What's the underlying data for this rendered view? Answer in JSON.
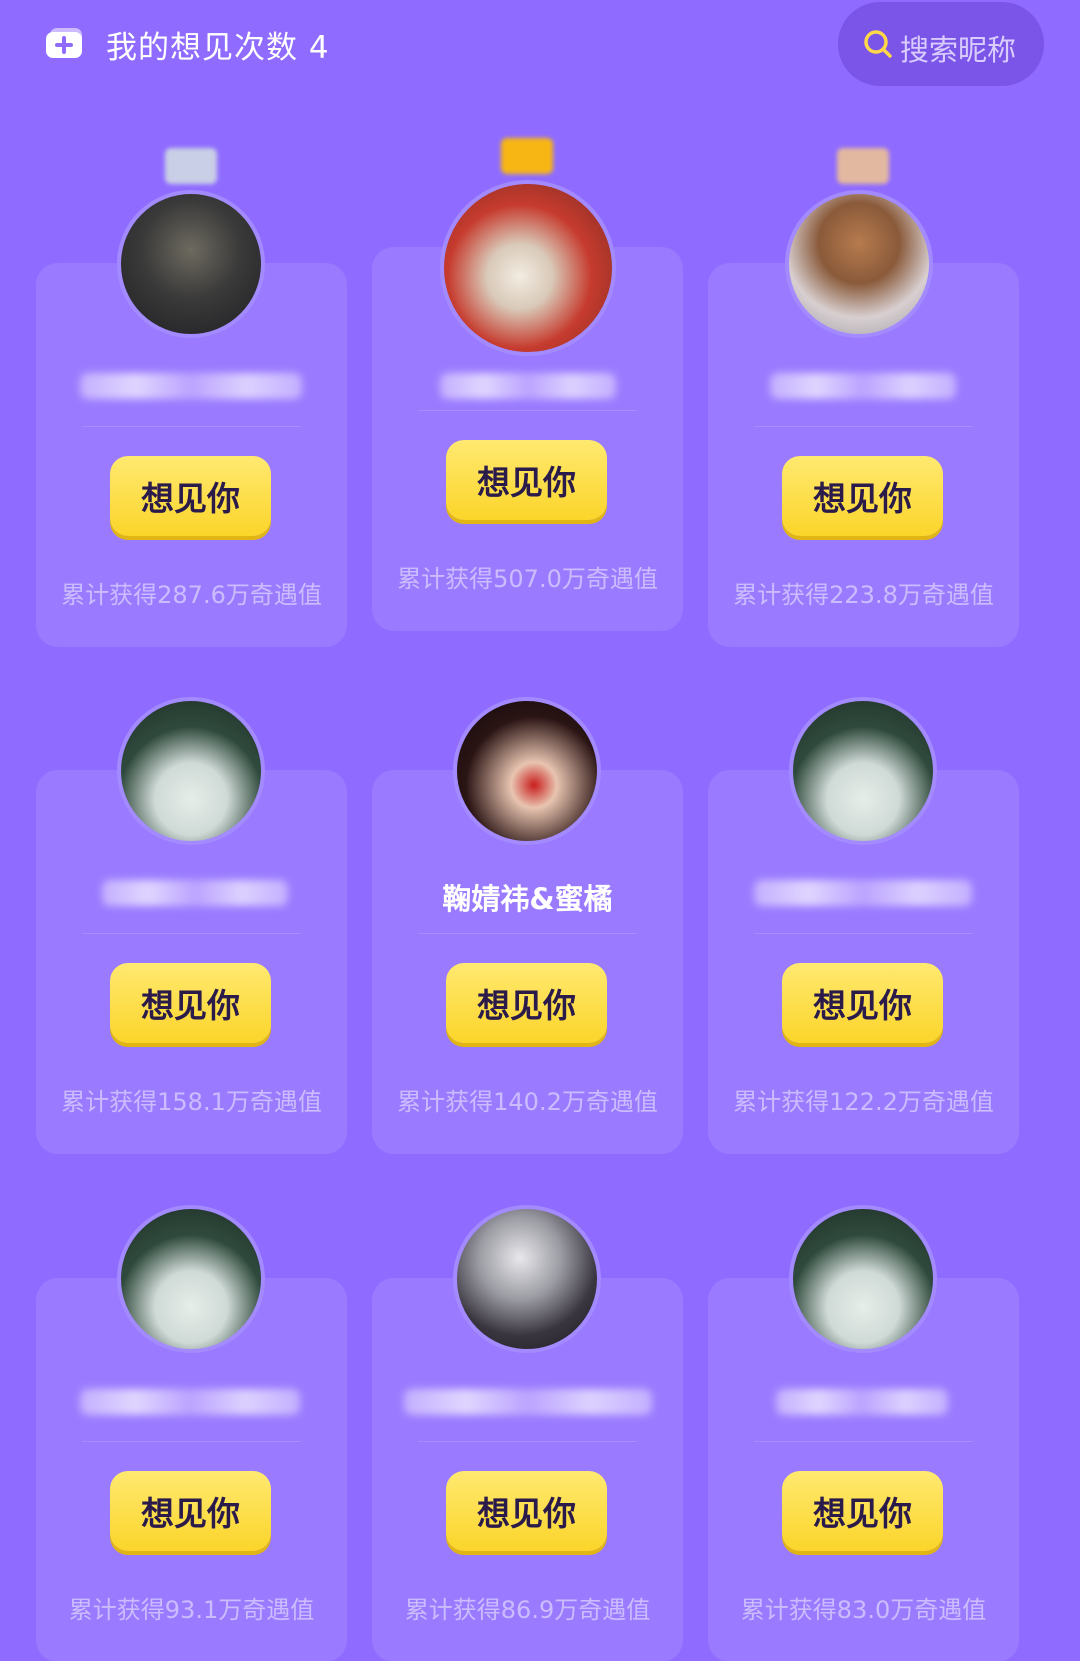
{
  "header": {
    "title": "我的想见次数 4",
    "search_placeholder": "搜索昵称"
  },
  "cards": [
    {
      "name": "",
      "button": "想见你",
      "stats": "累计获得287.6万奇遇值"
    },
    {
      "name": "",
      "button": "想见你",
      "stats": "累计获得507.0万奇遇值"
    },
    {
      "name": "",
      "button": "想见你",
      "stats": "累计获得223.8万奇遇值"
    },
    {
      "name": "",
      "button": "想见你",
      "stats": "累计获得158.1万奇遇值"
    },
    {
      "name": "鞠婧祎&蜜橘",
      "button": "想见你",
      "stats": "累计获得140.2万奇遇值"
    },
    {
      "name": "",
      "button": "想见你",
      "stats": "累计获得122.2万奇遇值"
    },
    {
      "name": "",
      "button": "想见你",
      "stats": "累计获得93.1万奇遇值"
    },
    {
      "name": "",
      "button": "想见你",
      "stats": "累计获得86.9万奇遇值"
    },
    {
      "name": "",
      "button": "想见你",
      "stats": "累计获得83.0万奇遇值"
    }
  ],
  "colors": {
    "background": "#8f6cff",
    "card": "#9a7bff",
    "button": "#fbd52a",
    "badge_silver": "#c9cfe6",
    "badge_gold": "#f7b614",
    "badge_bronze": "#e3b8a0"
  },
  "icons": {
    "ticket": "ticket-icon",
    "search": "search-icon"
  }
}
